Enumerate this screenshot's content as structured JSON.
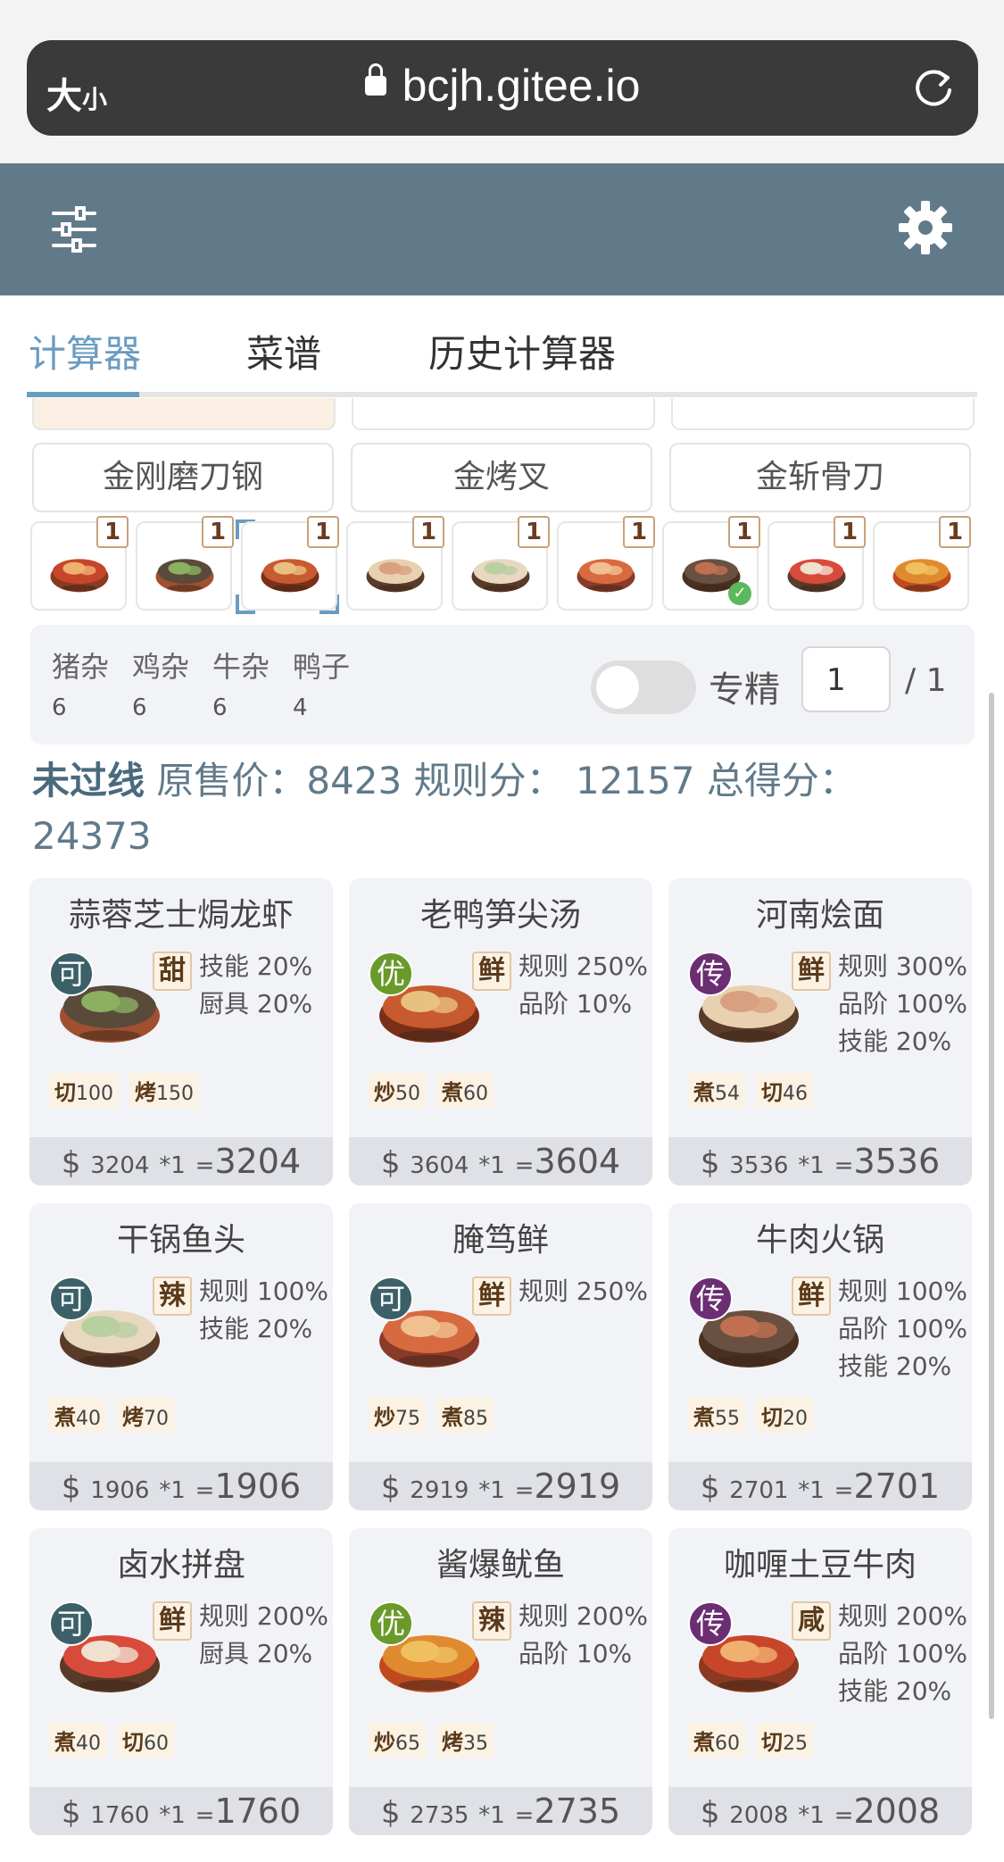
{
  "browser": {
    "text_size_label": "大",
    "text_size_small": "小",
    "url": "bcjh.gitee.io"
  },
  "tabs": [
    "计算器",
    "菜谱",
    "历史计算器"
  ],
  "equipment": [
    "金刚磨刀钢",
    "金烤叉",
    "金斩骨刀"
  ],
  "thumbnails": [
    {
      "count": "1"
    },
    {
      "count": "1"
    },
    {
      "count": "1"
    },
    {
      "count": "1"
    },
    {
      "count": "1"
    },
    {
      "count": "1"
    },
    {
      "count": "1",
      "checked": true
    },
    {
      "count": "1"
    },
    {
      "count": "1"
    }
  ],
  "materials": [
    {
      "name": "猪杂",
      "value": "6"
    },
    {
      "name": "鸡杂",
      "value": "6"
    },
    {
      "name": "牛杂",
      "value": "6"
    },
    {
      "name": "鸭子",
      "value": "4"
    }
  ],
  "specialization": {
    "label": "专精",
    "value": "1",
    "total": "/ 1"
  },
  "summary": {
    "status": "未过线",
    "rest": " 原售价：8423 规则分： 12157 总得分：24373"
  },
  "recipes": [
    {
      "name": "蒜蓉芝士焗龙虾",
      "rarity": "可",
      "rarity_color": "#3b6068",
      "taste": "甜",
      "buffs": [
        "技能 20%",
        "厨具 20%"
      ],
      "skills": [
        {
          "k": "切",
          "v": "100"
        },
        {
          "k": "烤",
          "v": "150"
        }
      ],
      "price": "$",
      "base": "3204",
      "mult": "*1",
      "eq": "=",
      "total": "3204"
    },
    {
      "name": "老鸭笋尖汤",
      "rarity": "优",
      "rarity_color": "#6a9a2a",
      "taste": "鲜",
      "buffs": [
        "规则 250%",
        "品阶 10%"
      ],
      "skills": [
        {
          "k": "炒",
          "v": "50"
        },
        {
          "k": "煮",
          "v": "60"
        }
      ],
      "price": "$",
      "base": "3604",
      "mult": "*1",
      "eq": "=",
      "total": "3604"
    },
    {
      "name": "河南烩面",
      "rarity": "传",
      "rarity_color": "#6c2e72",
      "taste": "鲜",
      "buffs": [
        "规则 300%",
        "品阶 100%",
        "技能 20%"
      ],
      "skills": [
        {
          "k": "煮",
          "v": "54"
        },
        {
          "k": "切",
          "v": "46"
        }
      ],
      "price": "$",
      "base": "3536",
      "mult": "*1",
      "eq": "=",
      "total": "3536"
    },
    {
      "name": "干锅鱼头",
      "rarity": "可",
      "rarity_color": "#3b6068",
      "taste": "辣",
      "buffs": [
        "规则 100%",
        "技能 20%"
      ],
      "skills": [
        {
          "k": "煮",
          "v": "40"
        },
        {
          "k": "烤",
          "v": "70"
        }
      ],
      "price": "$",
      "base": "1906",
      "mult": "*1",
      "eq": "=",
      "total": "1906"
    },
    {
      "name": "腌笃鲜",
      "rarity": "可",
      "rarity_color": "#3b6068",
      "taste": "鲜",
      "buffs": [
        "规则 250%"
      ],
      "skills": [
        {
          "k": "炒",
          "v": "75"
        },
        {
          "k": "煮",
          "v": "85"
        }
      ],
      "price": "$",
      "base": "2919",
      "mult": "*1",
      "eq": "=",
      "total": "2919"
    },
    {
      "name": "牛肉火锅",
      "rarity": "传",
      "rarity_color": "#6c2e72",
      "taste": "鲜",
      "buffs": [
        "规则 100%",
        "品阶 100%",
        "技能 20%"
      ],
      "skills": [
        {
          "k": "煮",
          "v": "55"
        },
        {
          "k": "切",
          "v": "20"
        }
      ],
      "price": "$",
      "base": "2701",
      "mult": "*1",
      "eq": "=",
      "total": "2701"
    },
    {
      "name": "卤水拼盘",
      "rarity": "可",
      "rarity_color": "#3b6068",
      "taste": "鲜",
      "buffs": [
        "规则 200%",
        "厨具 20%"
      ],
      "skills": [
        {
          "k": "煮",
          "v": "40"
        },
        {
          "k": "切",
          "v": "60"
        }
      ],
      "price": "$",
      "base": "1760",
      "mult": "*1",
      "eq": "=",
      "total": "1760"
    },
    {
      "name": "酱爆鱿鱼",
      "rarity": "优",
      "rarity_color": "#6a9a2a",
      "taste": "辣",
      "buffs": [
        "规则 200%",
        "品阶 10%"
      ],
      "skills": [
        {
          "k": "炒",
          "v": "65"
        },
        {
          "k": "烤",
          "v": "35"
        }
      ],
      "price": "$",
      "base": "2735",
      "mult": "*1",
      "eq": "=",
      "total": "2735"
    },
    {
      "name": "咖喱土豆牛肉",
      "rarity": "传",
      "rarity_color": "#6c2e72",
      "taste": "咸",
      "buffs": [
        "规则 200%",
        "品阶 100%",
        "技能 20%"
      ],
      "skills": [
        {
          "k": "煮",
          "v": "60"
        },
        {
          "k": "切",
          "v": "25"
        }
      ],
      "price": "$",
      "base": "2008",
      "mult": "*1",
      "eq": "=",
      "total": "2008"
    }
  ]
}
